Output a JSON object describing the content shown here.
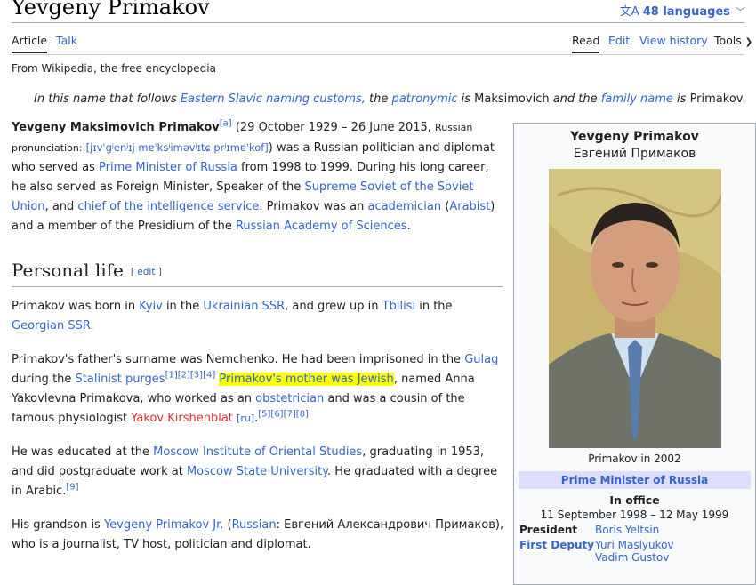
{
  "header": {
    "title": "Yevgeny Primakov",
    "languages": "48 languages"
  },
  "tabs": {
    "article": "Article",
    "talk": "Talk",
    "read": "Read",
    "edit": "Edit",
    "view_history": "View history",
    "tools": "Tools"
  },
  "from_wiki": "From Wikipedia, the free encyclopedia",
  "hatnote": {
    "t1": "In this name that follows ",
    "l1": "Eastern Slavic naming customs,",
    "t2": " the ",
    "l2": "patronymic",
    "t3": " is ",
    "n1": "Maksimovich",
    "t4": " and the ",
    "l3": "family name",
    "t5": " is ",
    "n2": "Primakov."
  },
  "lead": {
    "bold_name": "Yevgeny Maksimovich Primakov",
    "ref_a": "[a]",
    "dates": " (29 October 1929 – 26 June 2015, ",
    "russian_pron": "Russian pronunciation:",
    "ipa": "[jɪvˈɡʲenʲɪj mɐˈksʲiməvʲɪtɕ prʲɪmɐˈkof]",
    "t1": ") was a Russian politician and diplomat who served as ",
    "l_pm": "Prime Minister of Russia",
    "t2": " from 1998 to 1999. During his long career, he also served as Foreign Minister, Speaker of the ",
    "l_ss": "Supreme Soviet of the Soviet Union",
    "t3": ", and ",
    "l_chief": "chief of the intelligence service",
    "t4": ". Primakov was an ",
    "l_acad": "academician",
    "t5": " (",
    "l_arab": "Arabist",
    "t6": ") and a member of the Presidium of the ",
    "l_ras": "Russian Academy of Sciences",
    "t7": "."
  },
  "section": {
    "heading": "Personal life",
    "edit": "edit"
  },
  "p1": {
    "t1": "Primakov was born in ",
    "l_kyiv": "Kyiv",
    "t2": " in the ",
    "l_ussr": "Ukrainian SSR",
    "t3": ", and grew up in ",
    "l_tbilisi": "Tbilisi",
    "t4": " in the ",
    "l_gssr": "Georgian SSR",
    "t5": "."
  },
  "p2": {
    "t1": "Primakov's father's surname was Nemchenko. He had been imprisoned in the ",
    "l_gulag": "Gulag",
    "t2": " during the ",
    "l_purges": "Stalinist purges",
    "refs1": "[1][2][3][4]",
    "highlight": "Primakov's mother was Jewish",
    "t3": ", named Anna Yakovlevna Primakova, who worked as an ",
    "l_obst": "obstetrician",
    "t4": " and was a cousin of the famous physiologist ",
    "l_yakov": "Yakov Kirshenblat",
    "ru": "[ru]",
    "t5": ".",
    "refs2": "[5][6][7][8]"
  },
  "p3": {
    "t1": "He was educated at the ",
    "l_mios": "Moscow Institute of Oriental Studies",
    "t2": ", graduating in 1953, and did postgraduate work at ",
    "l_msu": "Moscow State University",
    "t3": ". He graduated with a degree in Arabic.",
    "ref9": "[9]"
  },
  "p4": {
    "t1": "His grandson is ",
    "l_jr": "Yevgeny Primakov Jr.",
    "t2": " (",
    "l_russian": "Russian",
    "t3": ": Евгений Александрович Примаков), who is a journalist, TV host, politician and diplomat."
  },
  "infobox": {
    "name": "Yevgeny Primakov",
    "native": "Евгений Примаков",
    "caption": "Primakov in 2002",
    "office": "Prime Minister of Russia",
    "in_office": "In office",
    "dates": "11 September 1998 – 12 May 1999",
    "president_label": "President",
    "president": "Boris Yeltsin",
    "deputy_label": "First Deputy",
    "deputy1": "Yuri Maslyukov",
    "deputy2": "Vadim Gustov"
  }
}
